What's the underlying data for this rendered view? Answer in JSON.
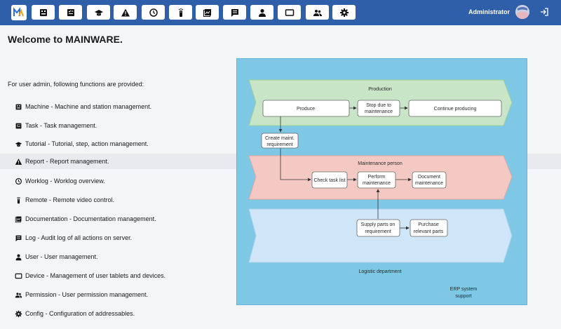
{
  "header": {
    "user_name": "Administrator",
    "nav_icons": [
      "machine-icon",
      "task-icon",
      "tutorial-icon",
      "report-icon",
      "worklog-icon",
      "remote-icon",
      "documentation-icon",
      "log-icon",
      "user-icon",
      "device-icon",
      "permission-icon",
      "config-icon"
    ]
  },
  "main": {
    "title": "Welcome to MAINWARE.",
    "intro": "For user admin, following functions are provided:",
    "functions": [
      {
        "label": "Machine - Machine and station management.",
        "icon": "machine-icon"
      },
      {
        "label": "Task - Task management.",
        "icon": "task-icon"
      },
      {
        "label": "Tutorial - Tutorial, step, action management.",
        "icon": "tutorial-icon"
      },
      {
        "label": "Report - Report management.",
        "icon": "report-icon"
      },
      {
        "label": "Worklog - Worklog overview.",
        "icon": "worklog-icon"
      },
      {
        "label": "Remote - Remote video control.",
        "icon": "remote-icon"
      },
      {
        "label": "Documentation - Documentation management.",
        "icon": "documentation-icon"
      },
      {
        "label": "Log - Audit log of all actions on server.",
        "icon": "log-icon"
      },
      {
        "label": "User - User management.",
        "icon": "user-icon"
      },
      {
        "label": "Device - Management of user tablets and devices.",
        "icon": "device-icon"
      },
      {
        "label": "Permission - User permission management.",
        "icon": "permission-icon"
      },
      {
        "label": "Config - Configuration of addressables.",
        "icon": "config-icon"
      }
    ]
  },
  "diagram": {
    "lanes": {
      "production": "Production",
      "maintenance": "Maintenance person",
      "logistic": "Logistic department",
      "erp_line1": "ERP system",
      "erp_line2": "support"
    },
    "nodes": {
      "produce": "Produce",
      "stop_line1": "Stop due to",
      "stop_line2": "maintenance",
      "continue": "Continue producing",
      "create_line1": "Create maint.",
      "create_line2": "requirement",
      "check": "Check task list",
      "perform_line1": "Perform",
      "perform_line2": "maintenance",
      "document_line1": "Document",
      "document_line2": "maintenance",
      "supply_line1": "Supply parts on",
      "supply_line2": "requirement",
      "purchase_line1": "Purchase",
      "purchase_line2": "relevant parts"
    }
  },
  "colors": {
    "topbar": "#2f5fa8",
    "production_lane": "#c9e5c7",
    "maintenance_lane": "#f5c9c3",
    "logistic_lane": "#cfe6f8",
    "diagram_bg": "#7ec8e6"
  }
}
